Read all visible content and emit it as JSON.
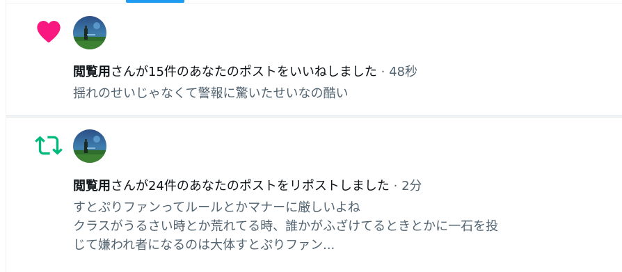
{
  "colors": {
    "like": "#f91880",
    "repost": "#00ba7c",
    "accent": "#1d9bf0",
    "text_primary": "#0f1419",
    "text_secondary": "#536471"
  },
  "notifications": [
    {
      "type_icon": "heart-icon",
      "user": "閲覧用",
      "action": "さんが15件のあなたのポストをいいねしました",
      "separator": " · ",
      "time": "48秒",
      "snippet_lines": [
        "揺れのせいじゃなくて警報に驚いたせいなの酷い"
      ]
    },
    {
      "type_icon": "repost-icon",
      "user": "閲覧用",
      "action": "さんが24件のあなたのポストをリポストしました",
      "separator": " · ",
      "time": "2分",
      "snippet_lines": [
        "すとぷりファンってルールとかマナーに厳しいよね",
        "クラスがうるさい時とか荒れてる時、誰かがふざけてるときとかに一石を投",
        "じて嫌われ者になるのは大体すとぷりファン..."
      ]
    }
  ]
}
